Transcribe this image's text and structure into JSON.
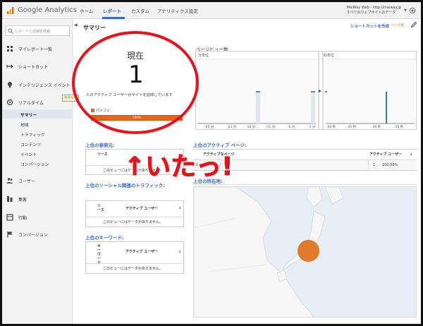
{
  "brand": {
    "name": "Google Analytics"
  },
  "nav": {
    "tabs": [
      "ホーム",
      "レポート",
      "カスタム",
      "アナリティクス設定"
    ],
    "active": "レポート"
  },
  "account": {
    "line1": "MeiWay Web - http://maiway.jp",
    "line2": "すべてのウェブサイトのデータ"
  },
  "sidebar": {
    "search_placeholder": "レポートと詳細を検索",
    "items": [
      {
        "label": "マイレポート一覧",
        "icon": "grid-icon"
      },
      {
        "label": "ショートカット",
        "icon": "shortcut-arrow-icon"
      },
      {
        "label": "インテリジェンス イベント",
        "icon": "lightbulb-icon"
      },
      {
        "label": "リアルタイム",
        "icon": "realtime-icon"
      }
    ],
    "realtime_sub": [
      "サマリー",
      "地域",
      "トラフィック",
      "コンテンツ",
      "イベント",
      "コンバージョン"
    ],
    "lower_items": [
      {
        "label": "ユーザー",
        "icon": "users-icon"
      },
      {
        "label": "集客",
        "icon": "acquisition-icon"
      },
      {
        "label": "行動",
        "icon": "behavior-icon"
      },
      {
        "label": "コンバージョン",
        "icon": "flag-icon"
      }
    ],
    "tooltip": "サマリー"
  },
  "main": {
    "title": "サマリー",
    "shortcut_link": "ショートカットを作成",
    "beta_label": "ベータ版"
  },
  "now": {
    "label": "現在",
    "count": "1",
    "description": "人のアクティブ ユーザーがサイトを訪問しています",
    "device_label": "パソコン",
    "device_percent_label": "100%",
    "device_share": 1.0
  },
  "pageviews": {
    "title": "ページビュー数",
    "per_minute_label": "分単位",
    "per_second_label": "秒単位",
    "minute_ticks": [
      "-26 分",
      "-21 分",
      "-16 分",
      "-11 分",
      "-6 分",
      "-1 分"
    ],
    "second_ticks": [
      "-60 秒",
      "-45 秒",
      "-30 秒",
      "-15 秒"
    ]
  },
  "referrals": {
    "title": "上位の参照元:",
    "columns": [
      "ソース"
    ],
    "empty": "このビューにはデータがありません。"
  },
  "social": {
    "title": "上位のソーシャル関連のトラフィック:",
    "columns": [
      "ソース",
      "アクティブ ユーザー"
    ],
    "empty": "このビューにはデータがありません。"
  },
  "keywords": {
    "title": "上位のキーワード:",
    "columns": [
      "キーワード",
      "アクティブ ユーザー"
    ],
    "empty": "このビューにはデータがありません。"
  },
  "active_pages": {
    "title": "上位のアクティブ ページ:",
    "columns": [
      "アクティブなページ",
      "アクティブ ユーザー"
    ],
    "rows": [
      {
        "index": "1.",
        "page": "/",
        "count": "1",
        "percent": "100.00%"
      }
    ]
  },
  "locations": {
    "title": "上位の所在地:"
  },
  "annotation": {
    "text": "↑いたっ!"
  },
  "colors": {
    "accent": "#3367d6",
    "orange": "#e06a1c",
    "annotation_red": "#e8121a"
  }
}
